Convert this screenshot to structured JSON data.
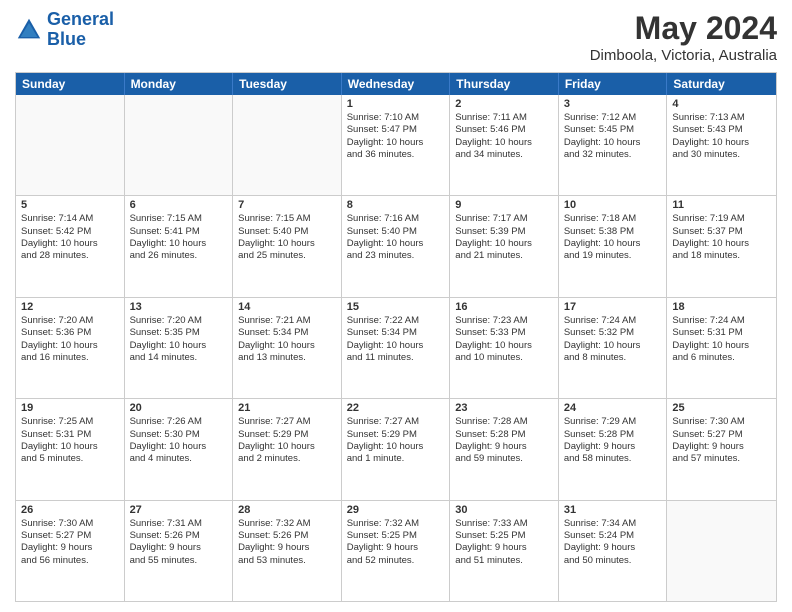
{
  "header": {
    "logo_general": "General",
    "logo_blue": "Blue",
    "month_year": "May 2024",
    "location": "Dimboola, Victoria, Australia"
  },
  "weekdays": [
    "Sunday",
    "Monday",
    "Tuesday",
    "Wednesday",
    "Thursday",
    "Friday",
    "Saturday"
  ],
  "weeks": [
    [
      {
        "day": "",
        "empty": true
      },
      {
        "day": "",
        "empty": true
      },
      {
        "day": "",
        "empty": true
      },
      {
        "day": "1",
        "lines": [
          "Sunrise: 7:10 AM",
          "Sunset: 5:47 PM",
          "Daylight: 10 hours",
          "and 36 minutes."
        ]
      },
      {
        "day": "2",
        "lines": [
          "Sunrise: 7:11 AM",
          "Sunset: 5:46 PM",
          "Daylight: 10 hours",
          "and 34 minutes."
        ]
      },
      {
        "day": "3",
        "lines": [
          "Sunrise: 7:12 AM",
          "Sunset: 5:45 PM",
          "Daylight: 10 hours",
          "and 32 minutes."
        ]
      },
      {
        "day": "4",
        "lines": [
          "Sunrise: 7:13 AM",
          "Sunset: 5:43 PM",
          "Daylight: 10 hours",
          "and 30 minutes."
        ]
      }
    ],
    [
      {
        "day": "5",
        "lines": [
          "Sunrise: 7:14 AM",
          "Sunset: 5:42 PM",
          "Daylight: 10 hours",
          "and 28 minutes."
        ]
      },
      {
        "day": "6",
        "lines": [
          "Sunrise: 7:15 AM",
          "Sunset: 5:41 PM",
          "Daylight: 10 hours",
          "and 26 minutes."
        ]
      },
      {
        "day": "7",
        "lines": [
          "Sunrise: 7:15 AM",
          "Sunset: 5:40 PM",
          "Daylight: 10 hours",
          "and 25 minutes."
        ]
      },
      {
        "day": "8",
        "lines": [
          "Sunrise: 7:16 AM",
          "Sunset: 5:40 PM",
          "Daylight: 10 hours",
          "and 23 minutes."
        ]
      },
      {
        "day": "9",
        "lines": [
          "Sunrise: 7:17 AM",
          "Sunset: 5:39 PM",
          "Daylight: 10 hours",
          "and 21 minutes."
        ]
      },
      {
        "day": "10",
        "lines": [
          "Sunrise: 7:18 AM",
          "Sunset: 5:38 PM",
          "Daylight: 10 hours",
          "and 19 minutes."
        ]
      },
      {
        "day": "11",
        "lines": [
          "Sunrise: 7:19 AM",
          "Sunset: 5:37 PM",
          "Daylight: 10 hours",
          "and 18 minutes."
        ]
      }
    ],
    [
      {
        "day": "12",
        "lines": [
          "Sunrise: 7:20 AM",
          "Sunset: 5:36 PM",
          "Daylight: 10 hours",
          "and 16 minutes."
        ]
      },
      {
        "day": "13",
        "lines": [
          "Sunrise: 7:20 AM",
          "Sunset: 5:35 PM",
          "Daylight: 10 hours",
          "and 14 minutes."
        ]
      },
      {
        "day": "14",
        "lines": [
          "Sunrise: 7:21 AM",
          "Sunset: 5:34 PM",
          "Daylight: 10 hours",
          "and 13 minutes."
        ]
      },
      {
        "day": "15",
        "lines": [
          "Sunrise: 7:22 AM",
          "Sunset: 5:34 PM",
          "Daylight: 10 hours",
          "and 11 minutes."
        ]
      },
      {
        "day": "16",
        "lines": [
          "Sunrise: 7:23 AM",
          "Sunset: 5:33 PM",
          "Daylight: 10 hours",
          "and 10 minutes."
        ]
      },
      {
        "day": "17",
        "lines": [
          "Sunrise: 7:24 AM",
          "Sunset: 5:32 PM",
          "Daylight: 10 hours",
          "and 8 minutes."
        ]
      },
      {
        "day": "18",
        "lines": [
          "Sunrise: 7:24 AM",
          "Sunset: 5:31 PM",
          "Daylight: 10 hours",
          "and 6 minutes."
        ]
      }
    ],
    [
      {
        "day": "19",
        "lines": [
          "Sunrise: 7:25 AM",
          "Sunset: 5:31 PM",
          "Daylight: 10 hours",
          "and 5 minutes."
        ]
      },
      {
        "day": "20",
        "lines": [
          "Sunrise: 7:26 AM",
          "Sunset: 5:30 PM",
          "Daylight: 10 hours",
          "and 4 minutes."
        ]
      },
      {
        "day": "21",
        "lines": [
          "Sunrise: 7:27 AM",
          "Sunset: 5:29 PM",
          "Daylight: 10 hours",
          "and 2 minutes."
        ]
      },
      {
        "day": "22",
        "lines": [
          "Sunrise: 7:27 AM",
          "Sunset: 5:29 PM",
          "Daylight: 10 hours",
          "and 1 minute."
        ]
      },
      {
        "day": "23",
        "lines": [
          "Sunrise: 7:28 AM",
          "Sunset: 5:28 PM",
          "Daylight: 9 hours",
          "and 59 minutes."
        ]
      },
      {
        "day": "24",
        "lines": [
          "Sunrise: 7:29 AM",
          "Sunset: 5:28 PM",
          "Daylight: 9 hours",
          "and 58 minutes."
        ]
      },
      {
        "day": "25",
        "lines": [
          "Sunrise: 7:30 AM",
          "Sunset: 5:27 PM",
          "Daylight: 9 hours",
          "and 57 minutes."
        ]
      }
    ],
    [
      {
        "day": "26",
        "lines": [
          "Sunrise: 7:30 AM",
          "Sunset: 5:27 PM",
          "Daylight: 9 hours",
          "and 56 minutes."
        ]
      },
      {
        "day": "27",
        "lines": [
          "Sunrise: 7:31 AM",
          "Sunset: 5:26 PM",
          "Daylight: 9 hours",
          "and 55 minutes."
        ]
      },
      {
        "day": "28",
        "lines": [
          "Sunrise: 7:32 AM",
          "Sunset: 5:26 PM",
          "Daylight: 9 hours",
          "and 53 minutes."
        ]
      },
      {
        "day": "29",
        "lines": [
          "Sunrise: 7:32 AM",
          "Sunset: 5:25 PM",
          "Daylight: 9 hours",
          "and 52 minutes."
        ]
      },
      {
        "day": "30",
        "lines": [
          "Sunrise: 7:33 AM",
          "Sunset: 5:25 PM",
          "Daylight: 9 hours",
          "and 51 minutes."
        ]
      },
      {
        "day": "31",
        "lines": [
          "Sunrise: 7:34 AM",
          "Sunset: 5:24 PM",
          "Daylight: 9 hours",
          "and 50 minutes."
        ]
      },
      {
        "day": "",
        "empty": true
      }
    ]
  ]
}
